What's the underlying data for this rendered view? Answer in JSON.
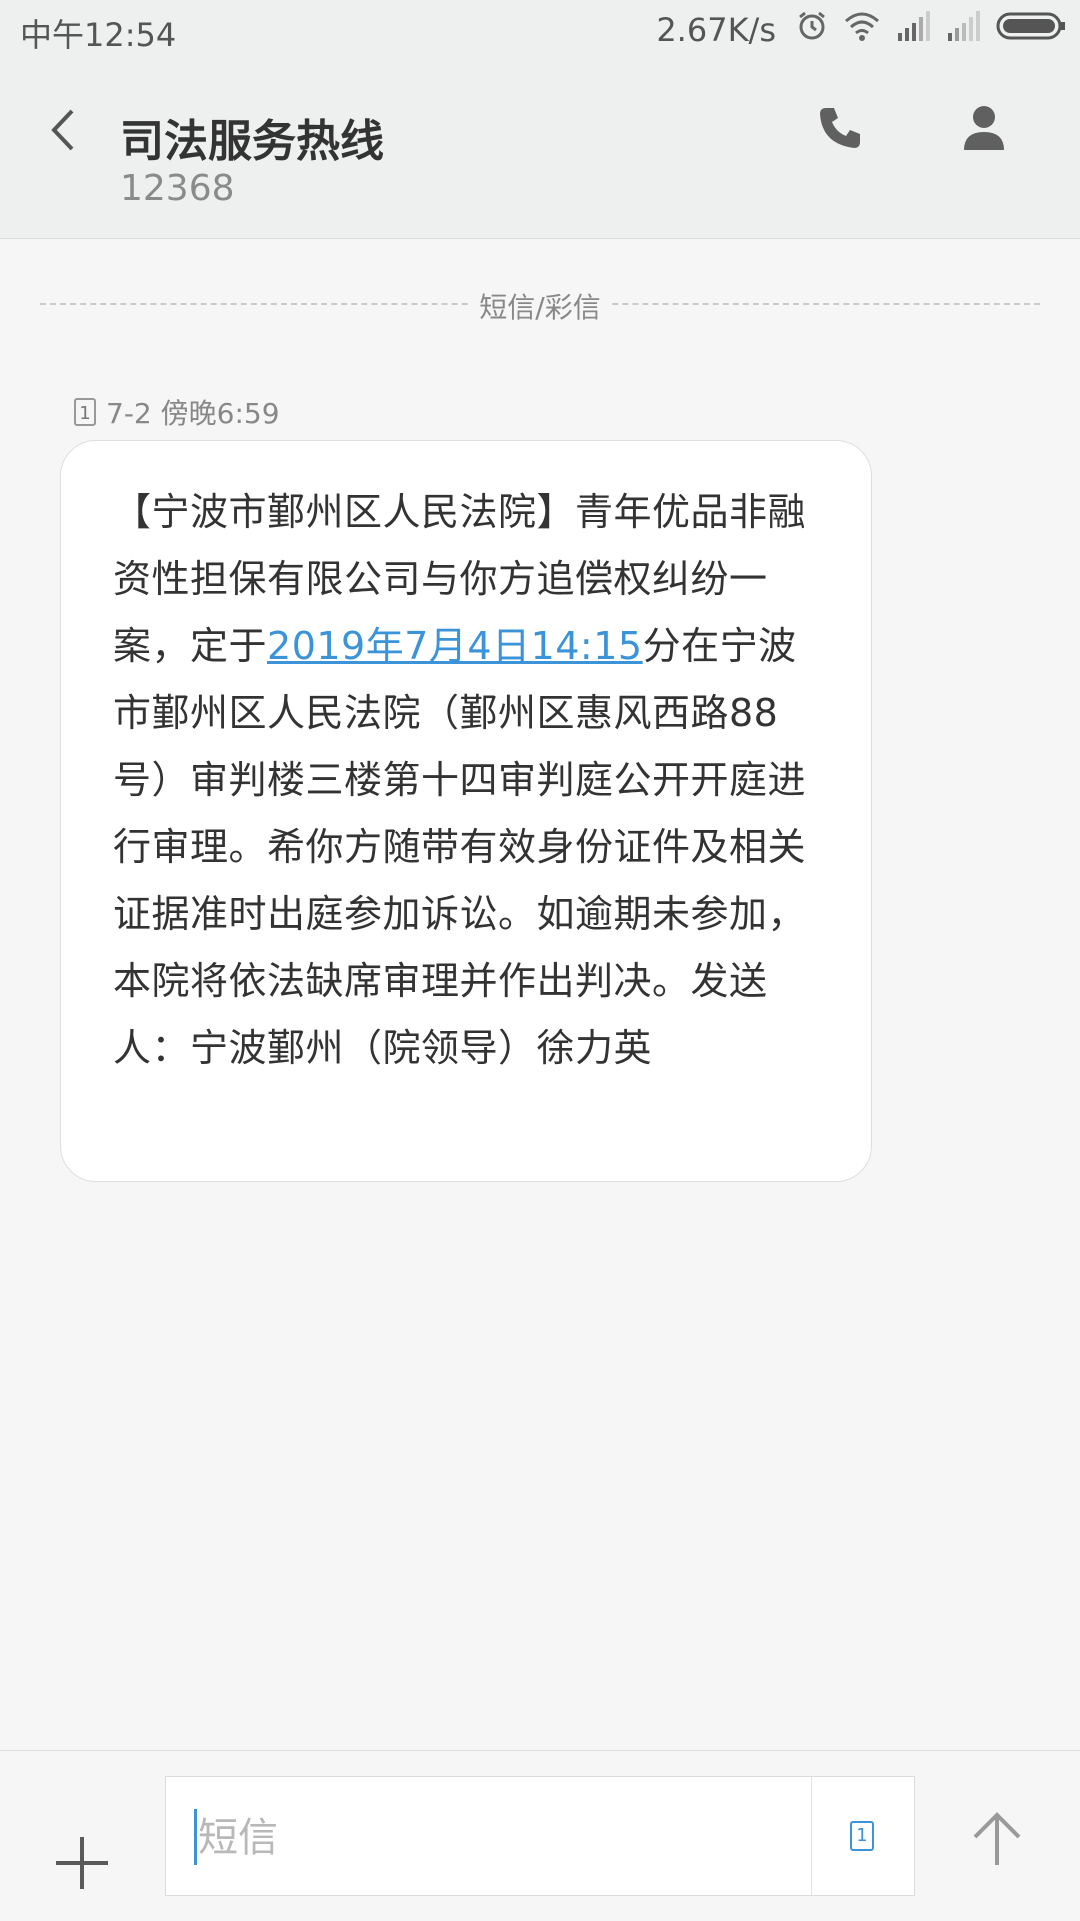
{
  "status_bar": {
    "time": "中午12:54",
    "network_speed": "2.67K/s",
    "icons": [
      "alarm-icon",
      "wifi-icon",
      "signal-icon",
      "signal-icon",
      "battery-icon"
    ]
  },
  "header": {
    "title": "司法服务热线",
    "number": "12368",
    "icons": [
      "back-icon",
      "phone-icon",
      "contact-icon"
    ]
  },
  "divider_label": "短信/彩信",
  "message": {
    "sim_label": "1",
    "timestamp": "7-2 傍晚6:59",
    "text_before_link": "【宁波市鄞州区人民法院】青年优品非融资性担保有限公司与你方追偿权纠纷一案，定于",
    "link_text": "2019年7月4日14:15",
    "text_after_link": "分在宁波市鄞州区人民法院（鄞州区惠风西路88号）审判楼三楼第十四审判庭公开开庭进行审理。希你方随带有效身份证件及相关证据准时出庭参加诉讼。如逾期未参加，本院将依法缺席审理并作出判决。发送人：宁波鄞州（院领导）徐力英"
  },
  "composer": {
    "placeholder": "短信",
    "value": "",
    "sim_label": "1",
    "icons": [
      "add-icon",
      "send-icon"
    ]
  },
  "colors": {
    "accent": "#3b93d8",
    "header_bg": "#eef0f0",
    "page_bg": "#f6f6f6"
  }
}
